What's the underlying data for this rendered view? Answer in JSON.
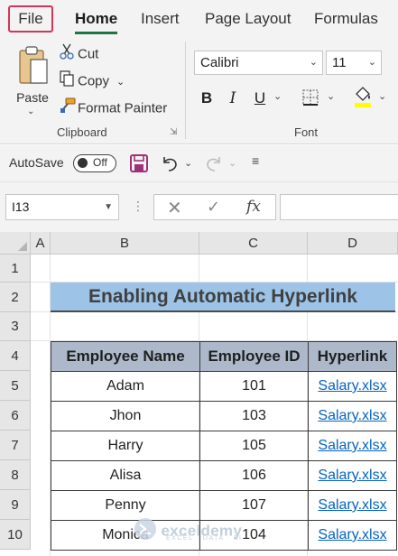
{
  "ribbon": {
    "tabs": [
      {
        "label": "File"
      },
      {
        "label": "Home"
      },
      {
        "label": "Insert"
      },
      {
        "label": "Page Layout"
      },
      {
        "label": "Formulas"
      }
    ],
    "clipboard": {
      "paste_label": "Paste",
      "cut_label": "Cut",
      "copy_label": "Copy",
      "format_painter_label": "Format Painter",
      "group_label": "Clipboard"
    },
    "font": {
      "font_name": "Calibri",
      "font_size": "11",
      "bold": "B",
      "italic": "I",
      "underline": "U",
      "group_label": "Font",
      "fill_color": "#ffff00"
    }
  },
  "qat": {
    "autosave_label": "AutoSave",
    "autosave_state": "Off",
    "save_icon_color": "#a0307a"
  },
  "formula_bar": {
    "name_box": "I13",
    "fx_label": "fx",
    "formula": ""
  },
  "sheet": {
    "columns": [
      "A",
      "B",
      "C",
      "D"
    ],
    "rows": [
      "1",
      "2",
      "3",
      "4",
      "5",
      "6",
      "7",
      "8",
      "9",
      "10"
    ],
    "title": "Enabling Automatic Hyperlink",
    "title_fill": "#9dc3e6",
    "header_fill": "#adb9ca",
    "link_color": "#0563c1",
    "table": {
      "headers": [
        "Employee Name",
        "Employee ID",
        "Hyperlink"
      ],
      "rows": [
        [
          "Adam",
          "101",
          "Salary.xlsx"
        ],
        [
          "Jhon",
          "103",
          "Salary.xlsx"
        ],
        [
          "Harry",
          "105",
          "Salary.xlsx"
        ],
        [
          "Alisa",
          "106",
          "Salary.xlsx"
        ],
        [
          "Penny",
          "107",
          "Salary.xlsx"
        ],
        [
          "Monica",
          "104",
          "Salary.xlsx"
        ]
      ]
    }
  },
  "watermark": {
    "name": "exceldemy",
    "tagline": "EXCEL · DATA · BI"
  }
}
